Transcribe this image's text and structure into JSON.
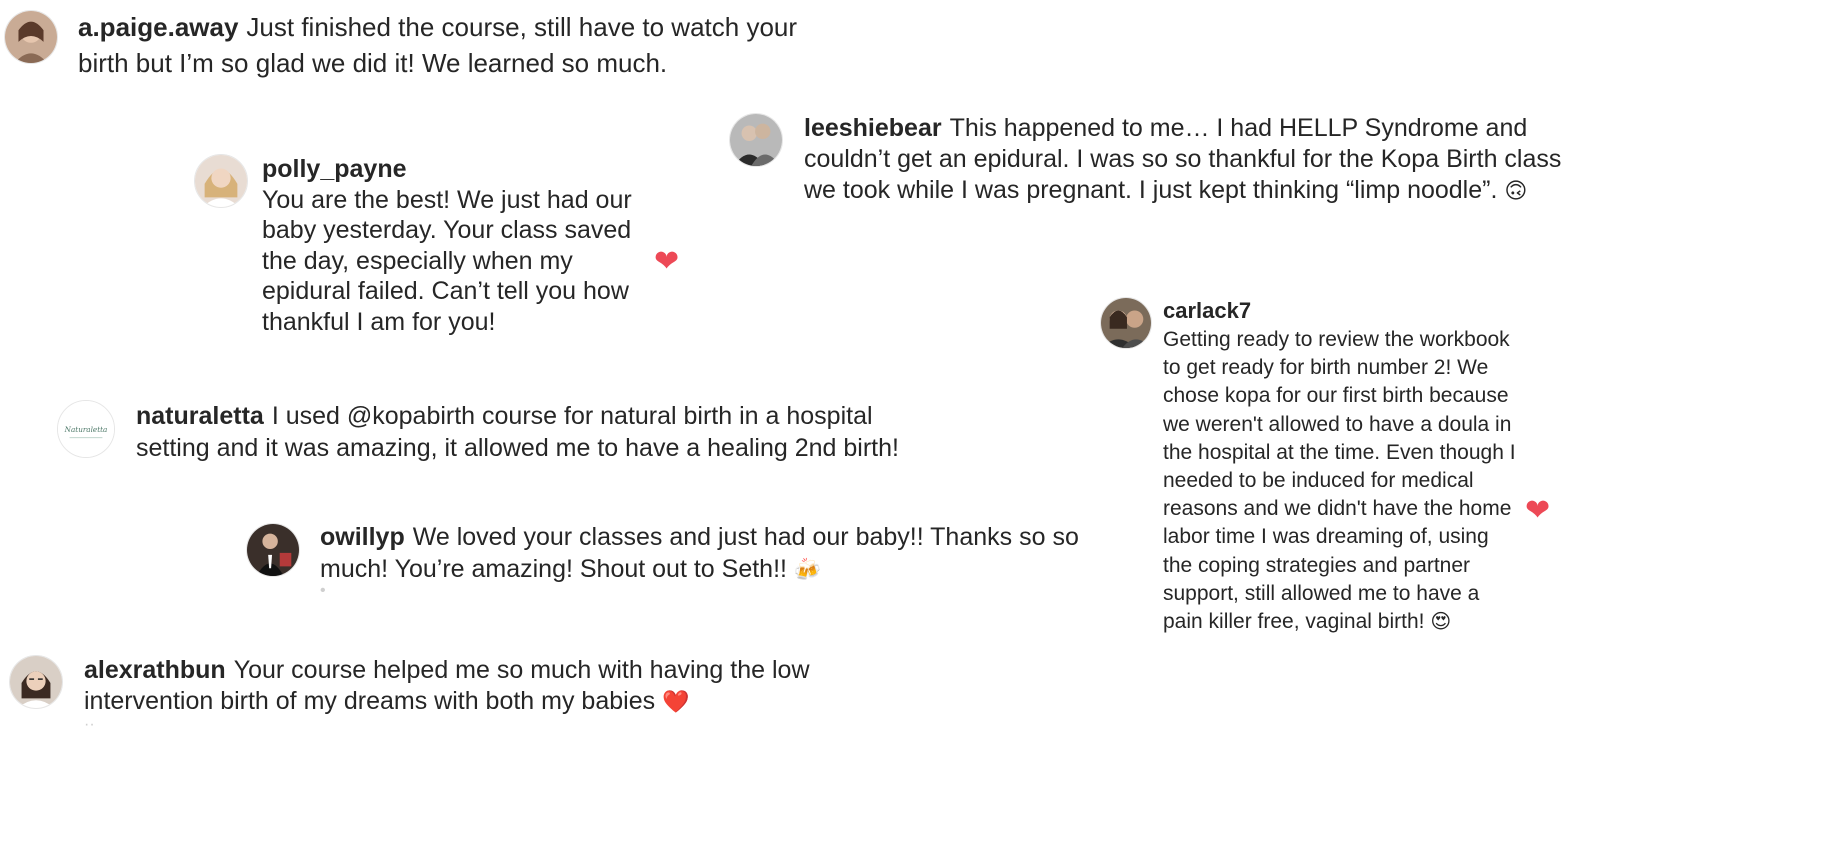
{
  "comments": [
    {
      "user": "a.paige.away",
      "text": "Just finished the course, still have to watch your birth but I’m so glad we did it! We learned so much."
    },
    {
      "user": "leeshiebear",
      "text": "This happened to me… I had HELLP Syndrome and couldn’t get an epidural. I was so so thankful for the Kopa Birth class we took while I was pregnant. I just kept thinking “limp noodle”.",
      "emoji": "🙃"
    },
    {
      "user": "polly_payne",
      "text": "You are the best! We just had our baby yesterday. Your class saved the day, especially when my epidural failed. Can’t tell you how thankful I am for you!",
      "liked": true
    },
    {
      "user": "carlack7",
      "text": "Getting ready to review the workbook to get ready for birth number 2! We chose kopa for our first birth because we weren't allowed to have a doula in the hospital at the time. Even though I needed to be induced for medical reasons and we didn't have the home labor time I was dreaming of, using the coping strategies and partner support, still allowed me to have a pain killer free, vaginal birth!",
      "emoji": "😍",
      "liked": true
    },
    {
      "user": "naturaletta",
      "text": "I used @kopabirth course for natural birth in a hospital setting and it was amazing, it allowed me to have a healing 2nd birth!",
      "avatar_text": "Naturaletta"
    },
    {
      "user": "owillyp",
      "text": "We loved your classes and just had our baby!! Thanks so so much! You’re amazing! Shout out to Seth!!",
      "emoji": "🍻"
    },
    {
      "user": "alexrathbun",
      "text": "Your course helped me so much with having the low intervention birth of my dreams with both my babies",
      "emoji": "❤️"
    }
  ],
  "icons": {
    "like": "heart-icon"
  },
  "colors": {
    "like": "#ed4956",
    "text": "#262626"
  }
}
